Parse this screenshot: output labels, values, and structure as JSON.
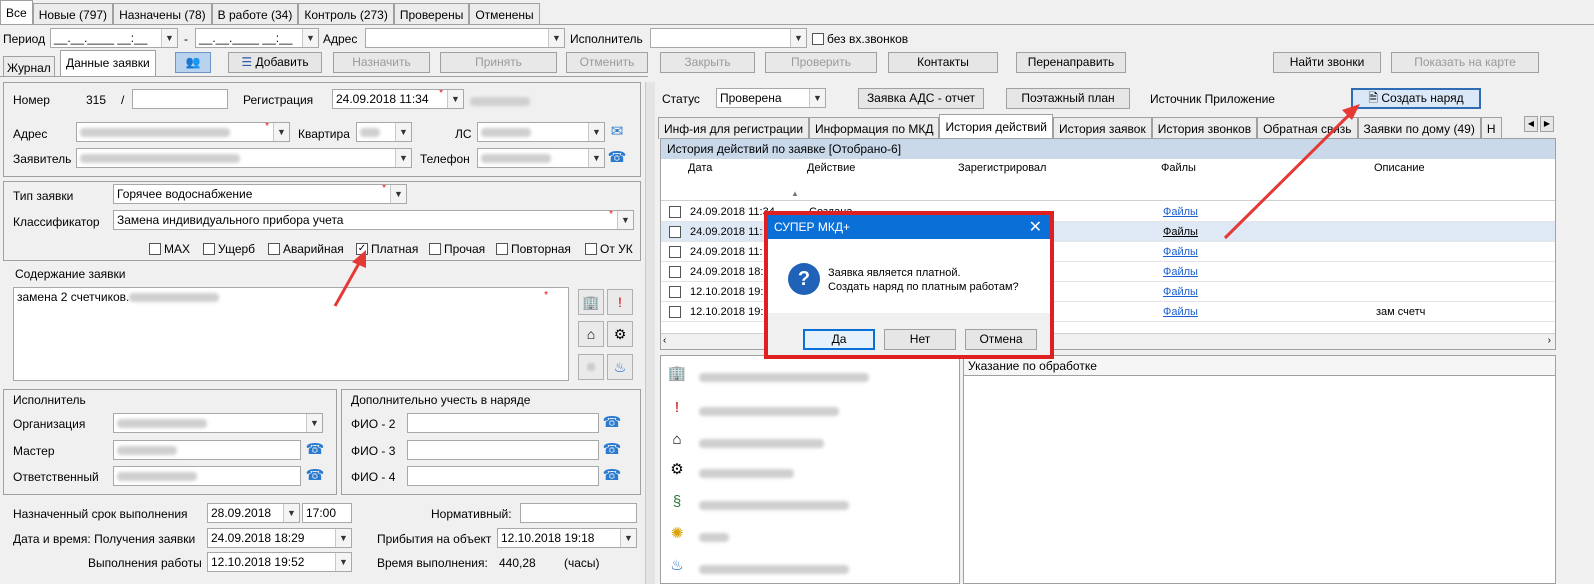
{
  "top_tabs": [
    "Все",
    "Новые (797)",
    "Назначены (78)",
    "В работе (34)",
    "Контроль (273)",
    "Проверены",
    "Отменены"
  ],
  "filter": {
    "period_label": "Период",
    "date_mask_from": "__.__.____ __:__",
    "dash": "-",
    "date_mask_to": "__.__.____ __:__",
    "address_label": "Адрес",
    "executor_label": "Исполнитель",
    "no_calls_label": "без вх.звонков"
  },
  "toolbar": {
    "tab_journal": "Журнал",
    "tab_data": "Данные заявки",
    "add": "Добавить",
    "assign": "Назначить",
    "accept": "Принять",
    "cancel": "Отменить",
    "close": "Закрыть",
    "check": "Проверить",
    "contacts": "Контакты",
    "redirect": "Перенаправить",
    "find_calls": "Найти звонки",
    "show_map": "Показать на карте"
  },
  "form": {
    "number_label": "Номер",
    "number": "315",
    "slash": "/",
    "reg_label": "Регистрация",
    "reg_value": "24.09.2018 11:34",
    "address_label": "Адрес",
    "apt_label": "Квартира",
    "ls_label": "ЛС",
    "applicant_label": "Заявитель",
    "phone_label": "Телефон",
    "type_label": "Тип заявки",
    "type_value": "Горячее водоснабжение",
    "class_label": "Классификатор",
    "class_value": "Замена индивидуального прибора учета",
    "checks": [
      "MAX",
      "Ущерб",
      "Аварийная",
      "Платная",
      "Прочая",
      "Повторная",
      "От УК"
    ],
    "content_label": "Содержание заявки",
    "content_value": "замена 2 счетчиков.",
    "executor_label": "Исполнитель",
    "org_label": "Организация",
    "master_label": "Мастер",
    "resp_label": "Ответственный",
    "extra_label": "Дополнительно учесть в наряде",
    "fio2": "ФИО - 2",
    "fio3": "ФИО - 3",
    "fio4": "ФИО - 4",
    "deadline_label": "Назначенный срок выполнения",
    "deadline_date": "28.09.2018",
    "deadline_time": "17:00",
    "normative_label": "Нормативный:",
    "received_label": "Дата и время: Получения заявки",
    "received_value": "24.09.2018 18:29",
    "arrival_label": "Прибытия на объект",
    "arrival_value": "12.10.2018 19:18",
    "done_label": "Выполнения работы",
    "done_value": "12.10.2018 19:52",
    "exec_time_label": "Время выполнения:",
    "exec_time_value": "440,28",
    "hours": "(часы)"
  },
  "right": {
    "status_label": "Статус",
    "status_value": "Проверена",
    "ads_report": "Заявка АДС - отчет",
    "floor_plan": "Поэтажный план",
    "source": "Источник Приложение",
    "create_order": "Создать наряд",
    "tabs": [
      "Инф-ия для регистрации",
      "Информация по МКД",
      "История действий",
      "История заявок",
      "История звонков",
      "Обратная связь",
      "Заявки по дому (49)",
      "Н"
    ],
    "history_title": "История действий по заявке  [Отобрано-6]",
    "columns": [
      "Дата",
      "Действие",
      "Зарегистрировал",
      "Файлы",
      "Описание"
    ],
    "rows": [
      {
        "date": "24.09.2018 11:34",
        "action": "Создана",
        "files": "Файлы",
        "desc": ""
      },
      {
        "date": "24.09.2018 11:",
        "action": "",
        "files": "Файлы",
        "desc": ""
      },
      {
        "date": "24.09.2018 11:",
        "action": "",
        "files": "Файлы",
        "desc": ""
      },
      {
        "date": "24.09.2018 18:",
        "action": "",
        "files": "Файлы",
        "desc": ""
      },
      {
        "date": "12.10.2018 19:",
        "action": "",
        "files": "Файлы",
        "desc": ""
      },
      {
        "date": "12.10.2018 19:",
        "action": "",
        "files": "Файлы",
        "desc": "зам счетч"
      }
    ],
    "instructions_label": "Указание по обработке"
  },
  "dialog": {
    "title": "СУПЕР МКД+",
    "line1": "Заявка является платной.",
    "line2": "Создать наряд по платным работам?",
    "yes": "Да",
    "no": "Нет",
    "cancel": "Отмена",
    "icon": "question-icon"
  },
  "colors": {
    "accent": "#0a6fd6",
    "highlight": "#e53935",
    "header_bar": "#c9d9ea"
  }
}
